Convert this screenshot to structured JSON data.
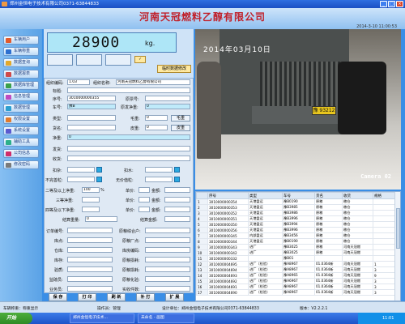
{
  "window": {
    "title": "郑州金恒电子技术有限公司0371-63844833"
  },
  "header": {
    "company": "河南天冠燃料乙醇有限公司",
    "datetime": "2014-3-10  11:00:53"
  },
  "sidebar": {
    "items": [
      {
        "label": "车辆用户",
        "color": "#e25a2c"
      },
      {
        "label": "车辆称重",
        "color": "#2c6fd0"
      },
      {
        "label": "数据查询",
        "color": "#e2a92c"
      },
      {
        "label": "数据报表",
        "color": "#d04a4a"
      },
      {
        "label": "数据库管理",
        "color": "#3aa04a"
      },
      {
        "label": "信息管理",
        "color": "#c04ac0"
      },
      {
        "label": "数据管理",
        "color": "#2c9fd0"
      },
      {
        "label": "权限设置",
        "color": "#e27a2c"
      },
      {
        "label": "系统设置",
        "color": "#5a5ad0"
      },
      {
        "label": "辅助工具",
        "color": "#2cb08a"
      },
      {
        "label": "公司信息",
        "color": "#d02c6a"
      },
      {
        "label": "修改密码",
        "color": "#7a7a7a"
      }
    ]
  },
  "weigh": {
    "value": "28900",
    "unit": "kg.",
    "modify_button": "临时数据修改"
  },
  "form": {
    "group_no_label": "组织编码:",
    "group_no": "1.03",
    "group_name_label": "组织名称:",
    "group_name": "河南天冠燃料乙醇有限公司",
    "mark_label": "标题:",
    "seq_label": "序号:",
    "seq": "3010000000355",
    "orig_no_label": "原票号:",
    "plate_label": "车号:",
    "plate": "豫B",
    "orig_net_label": "原发净重:",
    "orig_net": "0",
    "type_label": "类型:",
    "gross_label": "毛重:",
    "gross": "0",
    "gross_btn": "毛重",
    "goods_label": "货名:",
    "tare_label": "皮重:",
    "tare": "0",
    "tare_btn": "皮重",
    "net_label": "净重:",
    "net": "0",
    "sender_label": "发货:",
    "receiver_label": "收货:",
    "deduct_label": "扣杂:",
    "deduct_water_label": "扣水:",
    "invalid_label": "不完善粒:",
    "unsound_label": "无价值粒:",
    "pct": "%",
    "grade2_label": "二等及以上净重:",
    "grade2": "100",
    "price_label": "单价:",
    "amount_label": "金额:",
    "grade3_label": "三等净重:",
    "grade4_label": "四等及以下净重:",
    "settle_label": "结算重量:",
    "settle": "0",
    "settle_amount_label": "结算金额:",
    "order_label": "订单编号:",
    "orig_match_label": "原粮综合户:",
    "warehouse_label": "库点:",
    "factory_label": "原粮厂点:",
    "storage_label": "仓库:",
    "storage_no_label": "库房编码:",
    "location_label": "库存:",
    "shrink_label": "原粮损耗:",
    "moisture_label": "验质:",
    "shrink2_label": "原粮损耗:",
    "weigher_label": "监磅员:",
    "qc_label": "原粮化验:",
    "business_label": "业务员:",
    "actual_label": "实收件数:"
  },
  "actions": [
    {
      "label": "保 存"
    },
    {
      "label": "打 印"
    },
    {
      "label": "刷 新"
    },
    {
      "label": "补 打"
    },
    {
      "label": "扩 展"
    }
  ],
  "camera": {
    "timestamp": "2014年03月10日",
    "label": "Camera 02",
    "plate": "豫 93212"
  },
  "table": {
    "headers": [
      "",
      "序号",
      "类型",
      "车号",
      "货名",
      "收货",
      "规格"
    ],
    "rows": [
      [
        "1",
        "3010000000354",
        "天港盘运",
        "豫B0190",
        "原粮",
        "粮仓",
        ""
      ],
      [
        "2",
        "3010000000353",
        "天港盘运",
        "豫B3985",
        "原粮",
        "粮仓",
        ""
      ],
      [
        "3",
        "3010000000352",
        "天港盘运",
        "豫B3986",
        "原粮",
        "粮仓",
        ""
      ],
      [
        "4",
        "3010000000351",
        "天港盘运",
        "豫B3996",
        "原粮",
        "粮仓",
        ""
      ],
      [
        "5",
        "3010000000350",
        "天港盘运",
        "豫B3994",
        "原粮",
        "粮仓",
        ""
      ],
      [
        "6",
        "3010000000356",
        "天港盘运",
        "豫B3996",
        "原粮",
        "粮仓",
        ""
      ],
      [
        "7",
        "3010000000345",
        "内部盘运",
        "豫B3456",
        "原粮",
        "粮仓",
        ""
      ],
      [
        "8",
        "3010000000344",
        "天港盘运",
        "豫B0190",
        "原粮",
        "粮仓",
        ""
      ],
      [
        "9",
        "3010000000343",
        "进厂",
        "豫B3025",
        "原粮",
        "河南天冠燃",
        ""
      ],
      [
        "10",
        "3010000000342",
        "进厂",
        "豫B3025",
        "原粮",
        "河南天冠燃",
        ""
      ],
      [
        "11",
        "3010000000332",
        "",
        "豫B01",
        "",
        "",
        ""
      ],
      [
        "12",
        "3010000004695",
        "进厂（检验）",
        "豫A8967",
        "01.0364新",
        "河南天冠燃",
        "1"
      ],
      [
        "13",
        "3010000004694",
        "进厂（检验）",
        "豫A8967",
        "01.0364新",
        "河南天冠燃",
        "3"
      ],
      [
        "14",
        "3010000004693",
        "进厂（检验）",
        "豫A8965",
        "01.0364新",
        "河南天冠燃",
        "9"
      ],
      [
        "15",
        "3010000004692",
        "进厂（检验）",
        "豫A6967",
        "01.0364新",
        "河南天冠燃",
        "3"
      ],
      [
        "16",
        "3010000004691",
        "进厂（检验）",
        "豫A8967",
        "01.0364新",
        "河南天冠燃",
        "3"
      ],
      [
        "17",
        "3010000004690",
        "进厂（检验）",
        "豫A8967",
        "01.0364新",
        "河南天冠燃",
        "3"
      ]
    ]
  },
  "status": {
    "weight": "车辆称重：称重显示",
    "operator": "操作员：管理",
    "designer": "设计单位：郑州金恒电子技术有限公司0371-63844833",
    "version": "版本：V2.2.2.1"
  },
  "taskbar": {
    "start": "开始",
    "tasks": [
      "郑州金恒电子技术...",
      "未命名 - 画图"
    ],
    "clock": "11:01"
  }
}
